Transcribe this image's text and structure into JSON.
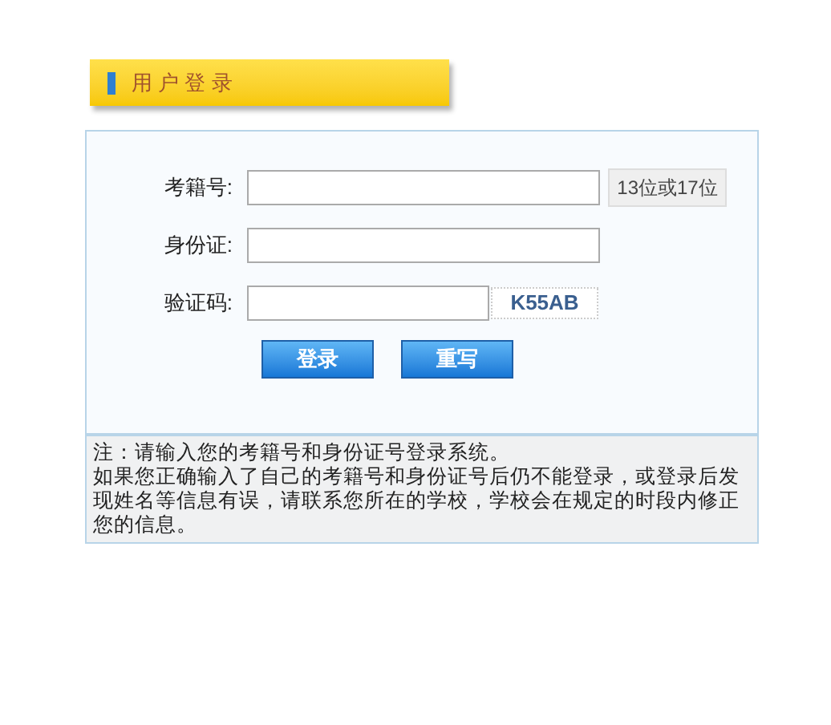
{
  "header": {
    "title": "用 户 登 录"
  },
  "form": {
    "fields": [
      {
        "kind": "text",
        "label": "考籍号:",
        "hint": "13位或17位"
      },
      {
        "kind": "text",
        "label": "身份证:"
      },
      {
        "kind": "captcha",
        "label": "验证码:",
        "code": "K55AB"
      }
    ],
    "buttons": [
      "登录",
      "重写"
    ]
  },
  "notes": [
    "注：请输入您的考籍号和身份证号登录系统。",
    "如果您正确输入了自己的考籍号和身份证号后仍不能登录，或登录后发现姓名等信息有误，请联系您所在的学校，学校会在规定的时段内修正您的信息。"
  ]
}
